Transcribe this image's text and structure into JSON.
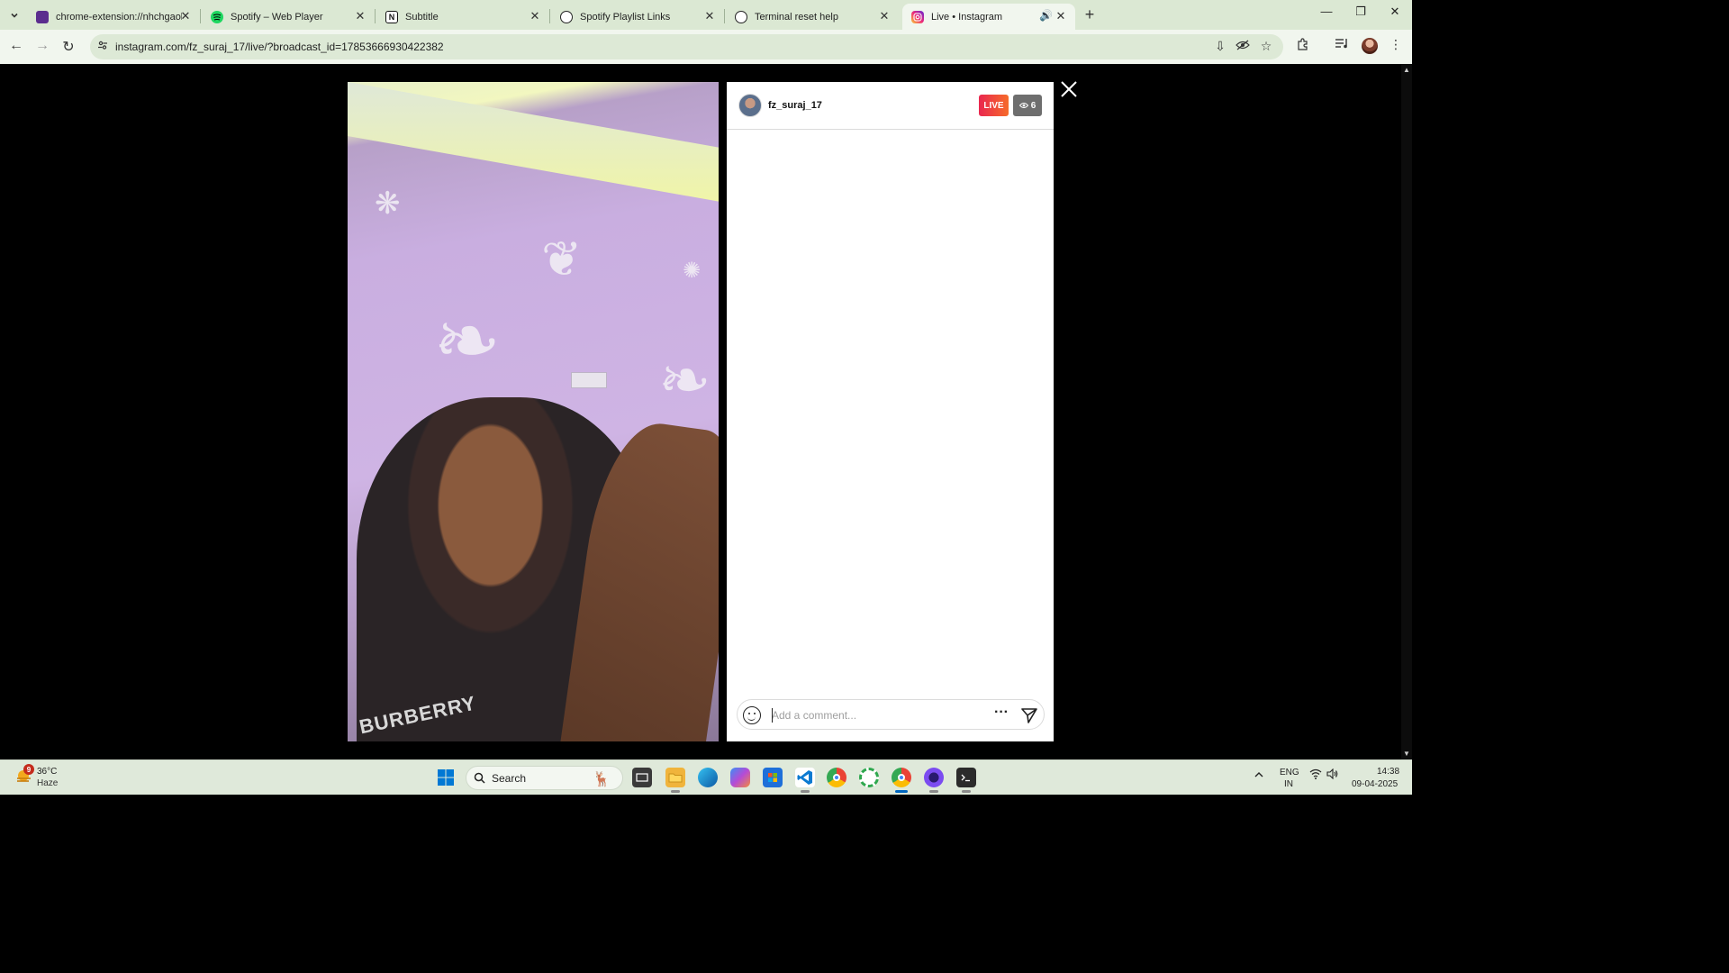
{
  "browser": {
    "tabs": [
      {
        "title": "chrome-extension://nhchgaollc",
        "favicon": "purple-extension",
        "active": false
      },
      {
        "title": "Spotify – Web Player",
        "favicon": "spotify-icon",
        "active": false
      },
      {
        "title": "Subtitle",
        "favicon": "notion-icon",
        "active": false
      },
      {
        "title": "Spotify Playlist Links",
        "favicon": "chatgpt-icon",
        "active": false
      },
      {
        "title": "Terminal reset help",
        "favicon": "chatgpt-icon",
        "active": false
      },
      {
        "title": "Live • Instagram",
        "favicon": "instagram-icon",
        "active": true
      }
    ],
    "url": "instagram.com/fz_suraj_17/live/?broadcast_id=17853666930422382"
  },
  "live": {
    "username": "fz_suraj_17",
    "live_label": "LIVE",
    "viewer_count": "6",
    "comment_placeholder": "Add a comment...",
    "video_text": "BURBERRY"
  },
  "taskbar": {
    "weather_badge": "9",
    "temperature": "36°C",
    "condition": "Haze",
    "search_label": "Search",
    "lang_line1": "ENG",
    "lang_line2": "IN",
    "time": "14:38",
    "date": "09-04-2025"
  },
  "colors": {
    "chrome_frame": "#dbe8d3",
    "live_gradient_start": "#e9274f",
    "live_gradient_end": "#f66b2a",
    "windows_accent": "#0067c0"
  }
}
